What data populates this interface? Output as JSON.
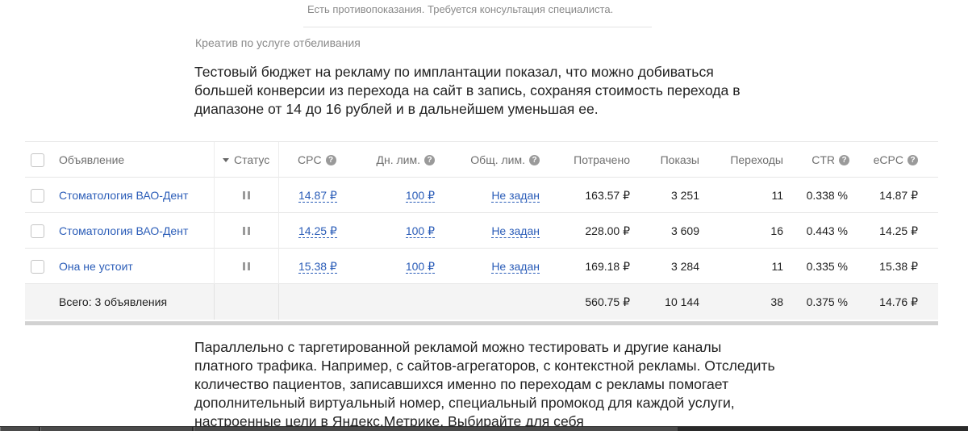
{
  "caption_top": "Есть противопоказания. Требуется консультация специалиста.",
  "subtitle": "Креатив по услуге отбеливания",
  "paragraph1": "Тестовый бюджет на рекламу по имплантации показал, что можно добиваться большей конверсии из перехода на сайт в запись, сохраняя стоимость перехода в диапазоне от 14 до 16 рублей  и в дальнейшем уменьшая ее.",
  "table": {
    "headers": {
      "name": "Объявление",
      "status": "Статус",
      "cpc": "CPC",
      "daily_limit": "Дн. лим.",
      "total_limit": "Общ. лим.",
      "spent": "Потрачено",
      "impressions": "Показы",
      "clicks": "Переходы",
      "ctr": "CTR",
      "ecpc": "eCPC"
    },
    "rows": [
      {
        "name": "Стоматология ВАО-Дент",
        "status": "paused",
        "cpc": "14.87 ₽",
        "daily_limit": "100 ₽",
        "total_limit": "Не задан",
        "spent": "163.57 ₽",
        "impressions": "3 251",
        "clicks": "11",
        "ctr": "0.338 %",
        "ecpc": "14.87 ₽"
      },
      {
        "name": "Стоматология ВАО-Дент",
        "status": "paused",
        "cpc": "14.25 ₽",
        "daily_limit": "100 ₽",
        "total_limit": "Не задан",
        "spent": "228.00 ₽",
        "impressions": "3 609",
        "clicks": "16",
        "ctr": "0.443 %",
        "ecpc": "14.25 ₽"
      },
      {
        "name": "Она не устоит",
        "status": "paused",
        "cpc": "15.38 ₽",
        "daily_limit": "100 ₽",
        "total_limit": "Не задан",
        "spent": "169.18 ₽",
        "impressions": "3 284",
        "clicks": "11",
        "ctr": "0.335 %",
        "ecpc": "15.38 ₽"
      }
    ],
    "total": {
      "label": "Всего: 3 объявления",
      "spent": "560.75 ₽",
      "impressions": "10 144",
      "clicks": "38",
      "ctr": "0.375 %",
      "ecpc": "14.76 ₽"
    }
  },
  "paragraph2": "Параллельно с таргетированной рекламой можно тестировать и другие каналы платного трафика. Например, с сайтов-агрегаторов, с контекстной рекламы. Отследить количество пациентов, записавшихся именно по переходам с рекламы помогает дополнительный виртуальный номер, специальный промокод для каждой услуги, настроенные цели в Яндекс.Метрике. Выбирайте для себя",
  "colors": {
    "link": "#2b5db8",
    "muted": "#8a8a8a",
    "total_row_bg": "#f4f4f4"
  },
  "icons": {
    "help": "question-circle-icon",
    "sort": "sort-desc-icon",
    "status": "pause-icon"
  }
}
